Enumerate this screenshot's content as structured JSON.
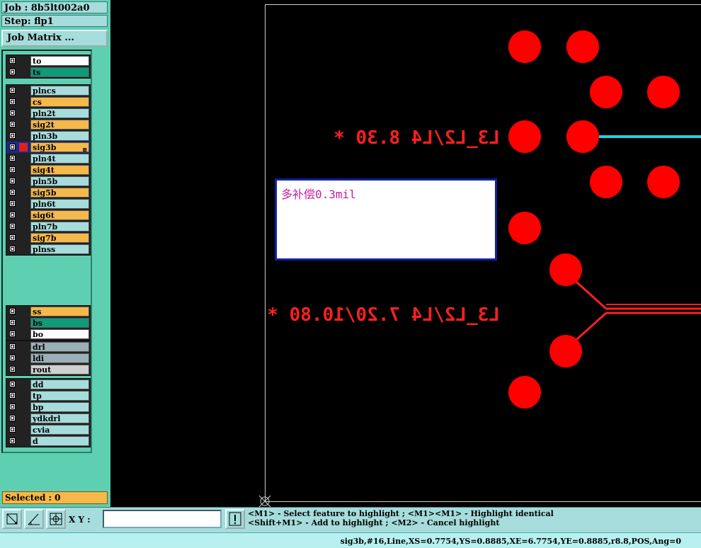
{
  "header": {
    "job_label": "Job : 8b5lt002a0",
    "step_label": "Step: flp1",
    "job_matrix_button": "Job Matrix ..."
  },
  "layers": {
    "groups": [
      {
        "items": [
          {
            "name": "to",
            "color": "#ffffff"
          },
          {
            "name": "ts",
            "color": "#0f9a7a"
          }
        ]
      },
      {
        "items": [
          {
            "name": "plncs",
            "color": "#a6dcdc"
          },
          {
            "name": "cs",
            "color": "#f5b84a"
          },
          {
            "name": "pln2t",
            "color": "#a6dcdc"
          },
          {
            "name": "sig2t",
            "color": "#f5b84a"
          },
          {
            "name": "pln3b",
            "color": "#a6dcdc"
          },
          {
            "name": "sig3b",
            "color": "#f5b84a",
            "active": true
          },
          {
            "name": "pln4t",
            "color": "#a6dcdc"
          },
          {
            "name": "sig4t",
            "color": "#f5b84a"
          },
          {
            "name": "pln5b",
            "color": "#a6dcdc"
          },
          {
            "name": "sig5b",
            "color": "#f5b84a"
          },
          {
            "name": "pln6t",
            "color": "#a6dcdc"
          },
          {
            "name": "sig6t",
            "color": "#f5b84a"
          },
          {
            "name": "pln7b",
            "color": "#a6dcdc"
          },
          {
            "name": "sig7b",
            "color": "#f5b84a"
          },
          {
            "name": "plnss",
            "color": "#a6dcdc"
          }
        ]
      },
      {
        "items": [
          {
            "name": "ss",
            "color": "#f5b84a"
          },
          {
            "name": "bs",
            "color": "#0f9a7a"
          },
          {
            "name": "bo",
            "color": "#ffffff"
          }
        ]
      },
      {
        "items": [
          {
            "name": "drl",
            "color": "#9ab0b8"
          },
          {
            "name": "ldi",
            "color": "#9ab0b8"
          },
          {
            "name": "rout",
            "color": "#d0d0d0"
          }
        ]
      },
      {
        "items": [
          {
            "name": "dd",
            "color": "#a6dcdc"
          },
          {
            "name": "tp",
            "color": "#a6dcdc"
          },
          {
            "name": "bp",
            "color": "#a6dcdc"
          },
          {
            "name": "ydkdrl",
            "color": "#a6dcdc"
          },
          {
            "name": "cvia",
            "color": "#a6dcdc"
          },
          {
            "name": "d",
            "color": "#a6dcdc"
          }
        ]
      }
    ]
  },
  "selected_label": "Selected : 0",
  "canvas": {
    "annotation_1": "L3_L2/L4 8.30 *",
    "annotation_2": "L3_L2/L4 7.20/10.80 *",
    "note": "多补偿0.3mil",
    "pad_color": "#ff0000",
    "trace_color_cyan": "#22d0e0"
  },
  "toolbar": {
    "xy_label": "X Y :",
    "xy_value": "",
    "message_line1": "<M1> - Select feature to highlight ; <M1><M1> - Highlight identical",
    "message_line2": "<Shift+M1> - Add to highlight ; <M2> - Cancel highlight"
  },
  "status": {
    "text": "sig3b,#16,Line,XS=0.7754,YS=0.8885,XE=6.7754,YE=0.8885,r8.8,POS,Ang=0"
  }
}
